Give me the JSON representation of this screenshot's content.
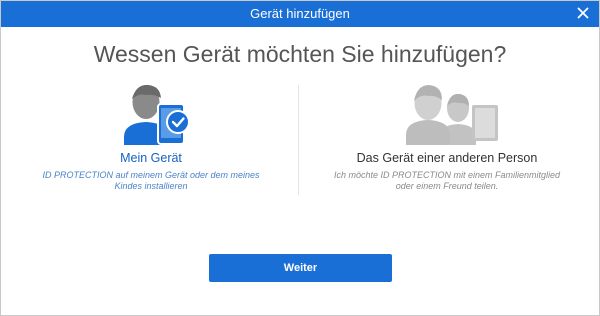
{
  "dialog": {
    "title": "Gerät hinzufügen",
    "close_icon": "close-icon"
  },
  "headline": "Wessen Gerät möchten Sie hinzufügen?",
  "options": [
    {
      "title": "Mein Gerät",
      "description": "ID PROTECTION auf meinem Gerät oder dem meines Kindes installieren",
      "icon": "person-with-phone-check-icon",
      "selected": true
    },
    {
      "title": "Das Gerät einer anderen Person",
      "description": "Ich möchte ID PROTECTION mit einem Familienmitglied oder einem Freund teilen.",
      "icon": "two-people-with-tablet-icon",
      "selected": false
    }
  ],
  "button": {
    "label": "Weiter"
  },
  "colors": {
    "accent": "#1a6fd6",
    "selected_text": "#1561c4",
    "muted_text": "#8a8a8a"
  }
}
